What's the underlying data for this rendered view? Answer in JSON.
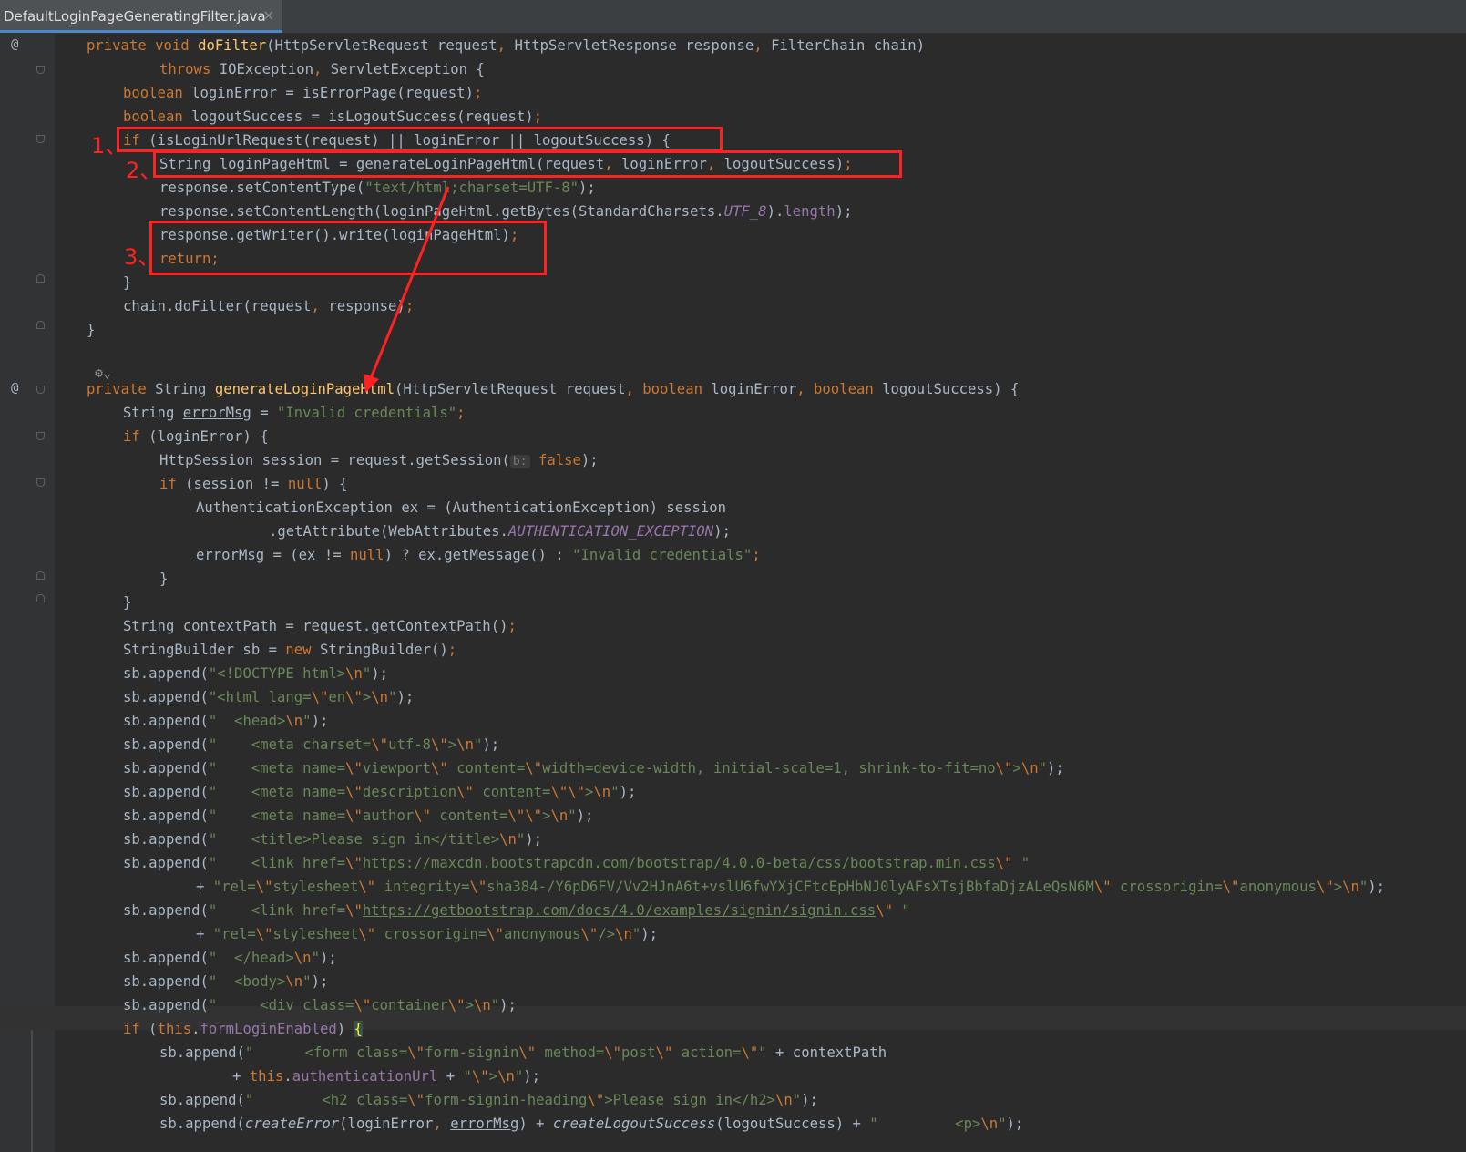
{
  "tab": {
    "title": "DefaultLoginPageGeneratingFilter.java",
    "close": "×"
  },
  "gutter": {
    "override_marker": "@"
  },
  "annotations": {
    "mark1": "1、",
    "mark2": "2、",
    "mark3": "3、"
  },
  "code": {
    "l1_a": "private void ",
    "l1_f": "doFilter",
    "l1_b": "(HttpServletRequest request",
    "l1_c": ", ",
    "l1_d": "HttpServletResponse response",
    "l1_e": ", ",
    "l1_g": "FilterChain chain)",
    "l2_a": "throws ",
    "l2_b": "IOException",
    "l2_c": ", ",
    "l2_d": "ServletException {",
    "l3_a": "boolean ",
    "l3_b": "loginError = isErrorPage(request)",
    "l3_c": ";",
    "l4_a": "boolean ",
    "l4_b": "logoutSuccess = isLogoutSuccess(request)",
    "l4_c": ";",
    "l5_a": "if ",
    "l5_b": "(isLoginUrlRequest(request) || loginError || logoutSuccess) {",
    "l6_a": "String loginPageHtml = generateLoginPageHtml(request",
    "l6_b": ", ",
    "l6_c": "loginError",
    "l6_d": ", ",
    "l6_e": "logoutSuccess)",
    "l6_f": ";",
    "l7_a": "response.setContentType(",
    "l7_b": "\"text/html;charset=UTF-8\"",
    "l7_c": ");",
    "l8_a": "response.setContentLength(loginPageHtml.getBytes(StandardCharsets.",
    "l8_b": "UTF_8",
    "l8_c": ").",
    "l8_d": "length",
    "l8_e": ");",
    "l9_a": "response.getWriter().write(loginPageHtml)",
    "l9_b": ";",
    "l10_a": "return;",
    "l11_a": "}",
    "l12_a": "chain.doFilter(request",
    "l12_b": ", ",
    "l12_c": "response)",
    "l12_d": ";",
    "l13_a": "}",
    "lens": "⚙⌄",
    "l15_a": "private ",
    "l15_b": "String ",
    "l15_f": "generateLoginPageHtml",
    "l15_c": "(HttpServletRequest request",
    "l15_d": ", ",
    "l15_e": "boolean ",
    "l15_g": "loginError",
    "l15_h": ", ",
    "l15_i": "boolean ",
    "l15_j": "logoutSuccess) {",
    "l16_a": "String ",
    "l16_b": "errorMsg",
    "l16_c": " = ",
    "l16_d": "\"Invalid credentials\"",
    "l16_e": ";",
    "l17_a": "if ",
    "l17_b": "(loginError) {",
    "l18_a": "HttpSession session = request.getSession(",
    "l18_hint": "b:",
    "l18_b": " false",
    "l18_c": ");",
    "l19_a": "if ",
    "l19_b": "(session != ",
    "l19_c": "null",
    "l19_d": ") {",
    "l20_a": "AuthenticationException ex = (AuthenticationException) session",
    "l21_a": ".getAttribute(WebAttributes.",
    "l21_b": "AUTHENTICATION_EXCEPTION",
    "l21_c": ");",
    "l22_a": "errorMsg",
    "l22_b": " = (ex != ",
    "l22_c": "null",
    "l22_d": ") ? ex.getMessage() : ",
    "l22_e": "\"Invalid credentials\"",
    "l22_f": ";",
    "l23_a": "}",
    "l24_a": "}",
    "l25_a": "String contextPath = request.getContextPath()",
    "l25_b": ";",
    "l26_a": "StringBuilder sb = ",
    "l26_b": "new ",
    "l26_c": "StringBuilder()",
    "l26_d": ";",
    "l27_a": "sb.append(",
    "l27_b": "\"<!DOCTYPE html>",
    "l27_c": "\\n",
    "l27_d": "\"",
    "l27_e": ");",
    "l28_a": "sb.append(",
    "l28_b": "\"<html lang=",
    "l28_c": "\\\"",
    "l28_d": "en",
    "l28_e": "\\\"",
    "l28_f": ">",
    "l28_g": "\\n",
    "l28_h": "\"",
    "l28_i": ");",
    "l29_a": "sb.append(",
    "l29_b": "\"  <head>",
    "l29_c": "\\n",
    "l29_d": "\"",
    "l29_e": ");",
    "l30_a": "sb.append(",
    "l30_b": "\"    <meta charset=",
    "l30_c": "\\\"",
    "l30_d": "utf-8",
    "l30_e": "\\\"",
    "l30_f": ">",
    "l30_g": "\\n",
    "l30_h": "\"",
    "l30_i": ");",
    "l31_a": "sb.append(",
    "l31_b": "\"    <meta name=",
    "l31_c": "\\\"",
    "l31_d": "viewport",
    "l31_e": "\\\"",
    "l31_f": " content=",
    "l31_g": "\\\"",
    "l31_h": "width=device-width, initial-scale=1, shrink-to-fit=no",
    "l31_i": "\\\"",
    "l31_j": ">",
    "l31_k": "\\n",
    "l31_l": "\"",
    "l31_m": ");",
    "l32_a": "sb.append(",
    "l32_b": "\"    <meta name=",
    "l32_c": "\\\"",
    "l32_d": "description",
    "l32_e": "\\\"",
    "l32_f": " content=",
    "l32_g": "\\\"\\\"",
    "l32_h": ">",
    "l32_i": "\\n",
    "l32_j": "\"",
    "l32_k": ");",
    "l33_a": "sb.append(",
    "l33_b": "\"    <meta name=",
    "l33_c": "\\\"",
    "l33_d": "author",
    "l33_e": "\\\"",
    "l33_f": " content=",
    "l33_g": "\\\"\\\"",
    "l33_h": ">",
    "l33_i": "\\n",
    "l33_j": "\"",
    "l33_k": ");",
    "l34_a": "sb.append(",
    "l34_b": "\"    <title>Please sign in</title>",
    "l34_c": "\\n",
    "l34_d": "\"",
    "l34_e": ");",
    "l35_a": "sb.append(",
    "l35_b": "\"    <link href=",
    "l35_c": "\\\"",
    "l35_d": "https://maxcdn.bootstrapcdn.com/bootstrap/4.0.0-beta/css/bootstrap.min.css",
    "l35_e": "\\\"",
    "l35_f": " \"",
    "l36_a": "+ ",
    "l36_b": "\"rel=",
    "l36_c": "\\\"",
    "l36_d": "stylesheet",
    "l36_e": "\\\"",
    "l36_f": " integrity=",
    "l36_g": "\\\"",
    "l36_h": "sha384-/Y6pD6FV/Vv2HJnA6t+vslU6fwYXjCFtcEpHbNJ0lyAFsXTsjBbfaDjzALeQsN6M",
    "l36_i": "\\\"",
    "l36_j": " crossorigin=",
    "l36_k": "\\\"",
    "l36_l": "anonymous",
    "l36_m": "\\\"",
    "l36_n": ">",
    "l36_o": "\\n",
    "l36_p": "\"",
    "l36_q": ");",
    "l37_a": "sb.append(",
    "l37_b": "\"    <link href=",
    "l37_c": "\\\"",
    "l37_d": "https://getbootstrap.com/docs/4.0/examples/signin/signin.css",
    "l37_e": "\\\"",
    "l37_f": " \"",
    "l38_a": "+ ",
    "l38_b": "\"rel=",
    "l38_c": "\\\"",
    "l38_d": "stylesheet",
    "l38_e": "\\\"",
    "l38_f": " crossorigin=",
    "l38_g": "\\\"",
    "l38_h": "anonymous",
    "l38_i": "\\\"",
    "l38_j": "/>",
    "l38_k": "\\n",
    "l38_l": "\"",
    "l38_m": ");",
    "l39_a": "sb.append(",
    "l39_b": "\"  </head>",
    "l39_c": "\\n",
    "l39_d": "\"",
    "l39_e": ");",
    "l40_a": "sb.append(",
    "l40_b": "\"  <body>",
    "l40_c": "\\n",
    "l40_d": "\"",
    "l40_e": ");",
    "l41_a": "sb.append(",
    "l41_b": "\"     <div class=",
    "l41_c": "\\\"",
    "l41_d": "container",
    "l41_e": "\\\"",
    "l41_f": ">",
    "l41_g": "\\n",
    "l41_h": "\"",
    "l41_i": ");",
    "l42_a": "if ",
    "l42_b": "(",
    "l42_c": "this",
    "l42_d": ".",
    "l42_e": "formLoginEnabled",
    "l42_f": ") ",
    "l42_g": "{",
    "l43_a": "sb.append(",
    "l43_b": "\"      <form class=",
    "l43_c": "\\\"",
    "l43_d": "form-signin",
    "l43_e": "\\\"",
    "l43_f": " method=",
    "l43_g": "\\\"",
    "l43_h": "post",
    "l43_i": "\\\"",
    "l43_j": " action=",
    "l43_k": "\\\"",
    "l43_l": "\"",
    "l43_m": " + contextPath",
    "l44_a": "+ ",
    "l44_b": "this",
    "l44_c": ".",
    "l44_d": "authenticationUrl",
    "l44_e": " + ",
    "l44_f": "\"",
    "l44_g": "\\\"",
    "l44_h": ">",
    "l44_i": "\\n",
    "l44_j": "\"",
    "l44_k": ");",
    "l45_a": "sb.append(",
    "l45_b": "\"        <h2 class=",
    "l45_c": "\\\"",
    "l45_d": "form-signin-heading",
    "l45_e": "\\\"",
    "l45_f": ">Please sign in</h2>",
    "l45_g": "\\n",
    "l45_h": "\"",
    "l45_i": ");",
    "l46_a": "sb.append(",
    "l46_b": "createError",
    "l46_c": "(loginError",
    "l46_d": ", ",
    "l46_e": "errorMsg",
    "l46_f": ") + ",
    "l46_g": "createLogoutSuccess",
    "l46_h": "(logoutSuccess) + ",
    "l46_i": "\"         <p>",
    "l46_j": "\\n",
    "l46_k": "\"",
    "l46_l": ");"
  }
}
